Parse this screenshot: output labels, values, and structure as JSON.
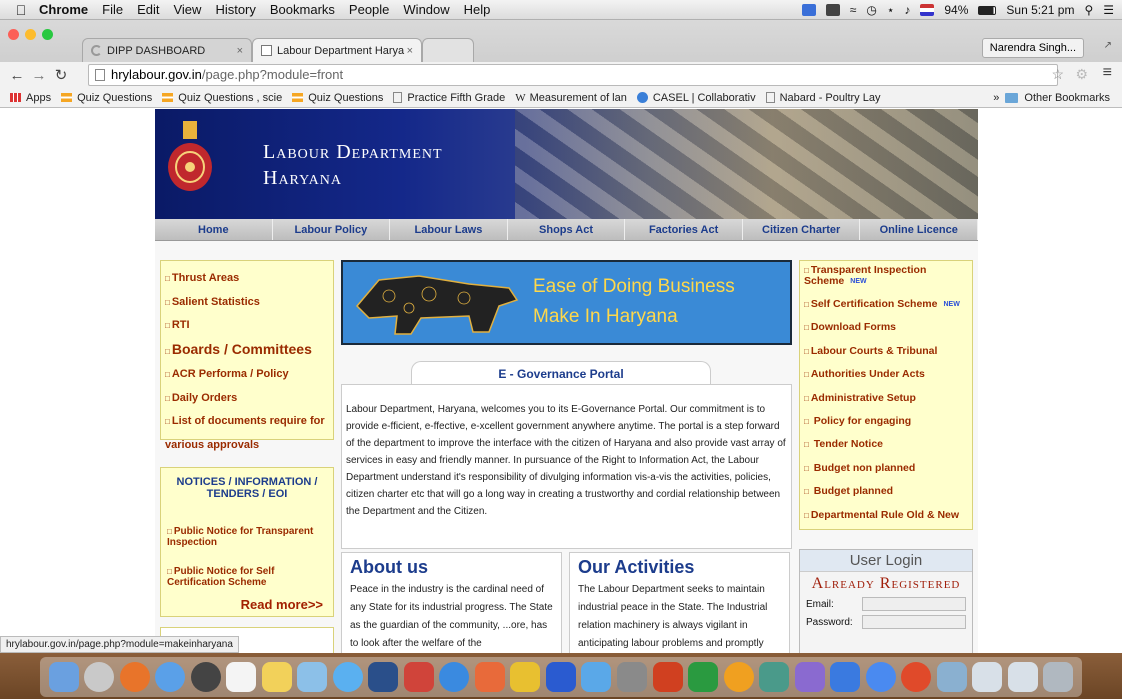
{
  "menubar": {
    "app": "Chrome",
    "items": [
      "File",
      "Edit",
      "View",
      "History",
      "Bookmarks",
      "People",
      "Window",
      "Help"
    ],
    "battery": "94%",
    "clock": "Sun 5:21 pm"
  },
  "tabs": [
    {
      "label": "DIPP DASHBOARD"
    },
    {
      "label": "Labour Department Harya"
    }
  ],
  "profile": "Narendra Singh...",
  "address": {
    "domain": "hrylabour.gov.in",
    "path": "/page.php?module=front"
  },
  "bookmarks": {
    "items": [
      {
        "label": "Apps",
        "icon": "apps-grid-icon"
      },
      {
        "label": "Quiz Questions",
        "icon": "bookmark-icon"
      },
      {
        "label": "Quiz Questions , scie",
        "icon": "bookmark-icon"
      },
      {
        "label": "Quiz Questions",
        "icon": "bookmark-icon"
      },
      {
        "label": "Practice Fifth Grade",
        "icon": "page-icon"
      },
      {
        "label": "Measurement of lan",
        "icon": "wikipedia-icon"
      },
      {
        "label": "CASEL | Collaborativ",
        "icon": "casel-icon"
      },
      {
        "label": "Nabard - Poultry Lay",
        "icon": "page-icon"
      }
    ],
    "overflow": "»",
    "other": "Other Bookmarks"
  },
  "site": {
    "title_line1": "Labour Department",
    "title_line2": "Haryana",
    "nav": [
      "Home",
      "Labour Policy",
      "Labour Laws",
      "Shops Act",
      "Factories Act",
      "Citizen Charter",
      "Online Licence"
    ],
    "left_links": [
      "Thrust Areas",
      "Salient Statistics",
      "RTI",
      "Boards / Committees",
      "ACR Performa / Policy",
      "Daily Orders",
      "List of documents require for",
      "various approvals"
    ],
    "notices_title": "NOTICES / INFORMATION / TENDERS / EOI",
    "notices": [
      "Public Notice for Transparent Inspection",
      "Public Notice for Self Certification Scheme"
    ],
    "read_more": "Read more>>",
    "banner_line1": "Ease of Doing Business",
    "banner_line2": "Make In Haryana",
    "portal_title": "E - Governance Portal",
    "portal_text": "Labour Department, Haryana, welcomes you to its E-Governance Portal. Our commitment is to provide e-fficient, e-ffective, e-xcellent government anywhere anytime. The portal is a step forward of the department to improve the interface with the citizen of Haryana and also provide vast array of services in easy and friendly manner. In pursuance of the Right to Information Act, the Labour Department understand it's responsibility of divulging information vis-a-vis the activities, policies, citizen charter etc that will go a long way in creating a trustworthy and cordial relationship between the Department and the Citizen.",
    "about_title": "About us",
    "about_text": "Peace in the industry is the cardinal need of any State for its industrial progress. The State as the guardian of the community, ...ore, has to look after the welfare of the",
    "activities_title": "Our Activities",
    "activities_text": "The Labour Department seeks to maintain industrial peace in the State. The Industrial relation machinery is always vigilant in anticipating labour problems and promptly",
    "right_links": [
      {
        "label": "Transparent Inspection Scheme",
        "new": "NEW"
      },
      {
        "label": "Self Certification Scheme",
        "new": "NEW"
      },
      {
        "label": "Download Forms",
        "new": ""
      },
      {
        "label": "Labour Courts & Tribunal",
        "new": ""
      },
      {
        "label": "Authorities Under Acts",
        "new": ""
      },
      {
        "label": "Administrative Setup",
        "new": ""
      },
      {
        "label": "Policy for engaging",
        "new": ""
      },
      {
        "label": "Tender Notice",
        "new": ""
      },
      {
        "label": "Budget non planned",
        "new": ""
      },
      {
        "label": "Budget planned",
        "new": ""
      },
      {
        "label": "Departmental Rule Old & New",
        "new": ""
      }
    ],
    "login_title": "User Login",
    "login_sub": "Already Registered",
    "email_label": "Email:",
    "password_label": "Password:"
  },
  "status_url": "hrylabour.gov.in/page.php?module=makeinharyana",
  "colors": {
    "link_red": "#9a2b00",
    "nav_blue": "#1c3c8c",
    "banner_blue": "#3a8ad6",
    "banner_text": "#ffd84a",
    "side_bg": "#ffffcc"
  }
}
